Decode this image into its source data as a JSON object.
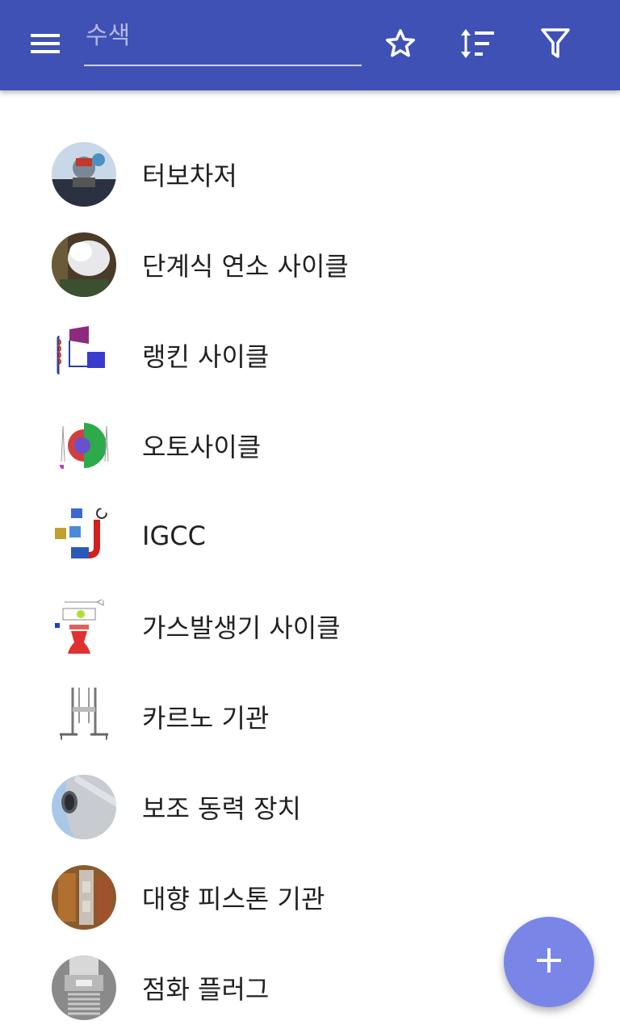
{
  "appbar": {
    "search_placeholder": "수색",
    "search_value": "",
    "icons": [
      "menu-icon",
      "star-icon",
      "sort-icon",
      "filter-icon"
    ],
    "color": "#3f51b5"
  },
  "items": [
    {
      "label": "터보차저",
      "icon": "turbocharger-thumbnail"
    },
    {
      "label": "단계식 연소 사이클",
      "icon": "staged-combustion-thumbnail"
    },
    {
      "label": "랭킨 사이클",
      "icon": "rankine-cycle-thumbnail"
    },
    {
      "label": "오토사이클",
      "icon": "otto-cycle-thumbnail"
    },
    {
      "label": "IGCC",
      "icon": "igcc-thumbnail"
    },
    {
      "label": "가스발생기 사이클",
      "icon": "gas-generator-cycle-thumbnail"
    },
    {
      "label": "카르노 기관",
      "icon": "carnot-engine-thumbnail"
    },
    {
      "label": "보조 동력 장치",
      "icon": "auxiliary-power-unit-thumbnail"
    },
    {
      "label": "대향 피스톤 기관",
      "icon": "opposed-piston-engine-thumbnail"
    },
    {
      "label": "점화 플러그",
      "icon": "spark-plug-thumbnail"
    }
  ],
  "fab": {
    "icon": "plus-icon",
    "color": "#7986e8"
  }
}
